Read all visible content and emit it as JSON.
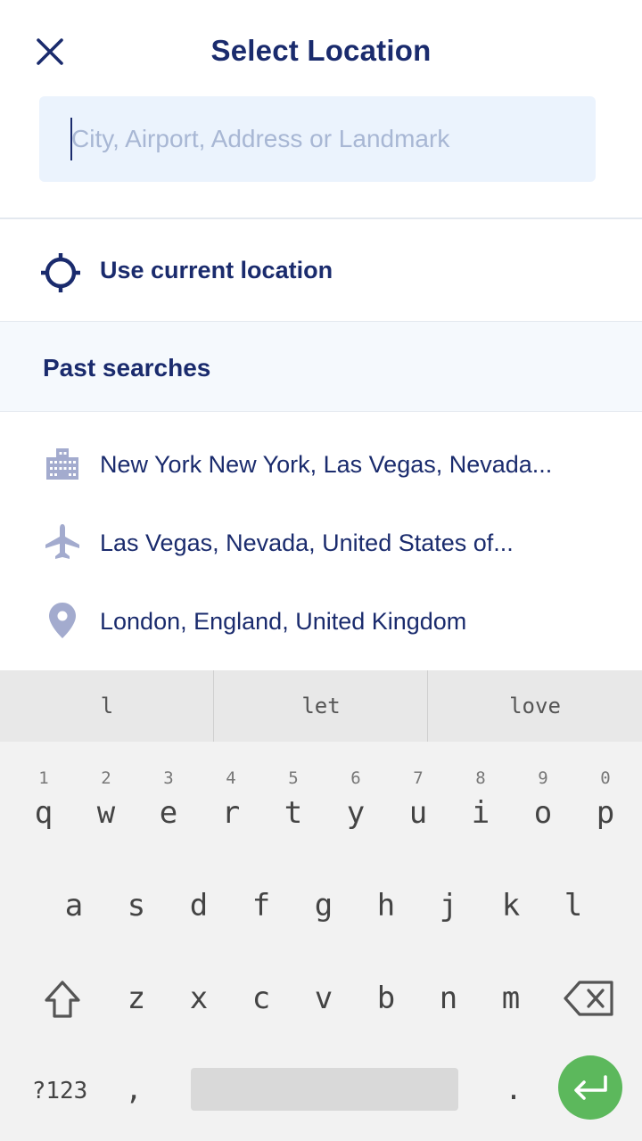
{
  "header": {
    "title": "Select Location",
    "close_icon": "close-icon"
  },
  "search": {
    "placeholder": "City, Airport, Address or Landmark",
    "value": ""
  },
  "current_location": {
    "label": "Use current location",
    "icon": "crosshair-icon"
  },
  "past_searches": {
    "title": "Past searches",
    "items": [
      {
        "label": "New York New York, Las Vegas, Nevada...",
        "icon": "building-icon"
      },
      {
        "label": "Las Vegas, Nevada, United States of...",
        "icon": "airplane-icon"
      },
      {
        "label": "London, England, United Kingdom",
        "icon": "map-pin-icon"
      }
    ]
  },
  "keyboard": {
    "suggestions": [
      "l",
      "let",
      "love"
    ],
    "row1": [
      {
        "letter": "q",
        "digit": "1"
      },
      {
        "letter": "w",
        "digit": "2"
      },
      {
        "letter": "e",
        "digit": "3"
      },
      {
        "letter": "r",
        "digit": "4"
      },
      {
        "letter": "t",
        "digit": "5"
      },
      {
        "letter": "y",
        "digit": "6"
      },
      {
        "letter": "u",
        "digit": "7"
      },
      {
        "letter": "i",
        "digit": "8"
      },
      {
        "letter": "o",
        "digit": "9"
      },
      {
        "letter": "p",
        "digit": "0"
      }
    ],
    "row2": [
      "a",
      "s",
      "d",
      "f",
      "g",
      "h",
      "j",
      "k",
      "l"
    ],
    "row3": [
      "z",
      "x",
      "c",
      "v",
      "b",
      "n",
      "m"
    ],
    "symbols_label": "?123",
    "comma": ",",
    "period": ".",
    "colors": {
      "enter": "#5cb85c",
      "accent": "#1a2b6d",
      "icon_muted": "#a3abce"
    }
  }
}
